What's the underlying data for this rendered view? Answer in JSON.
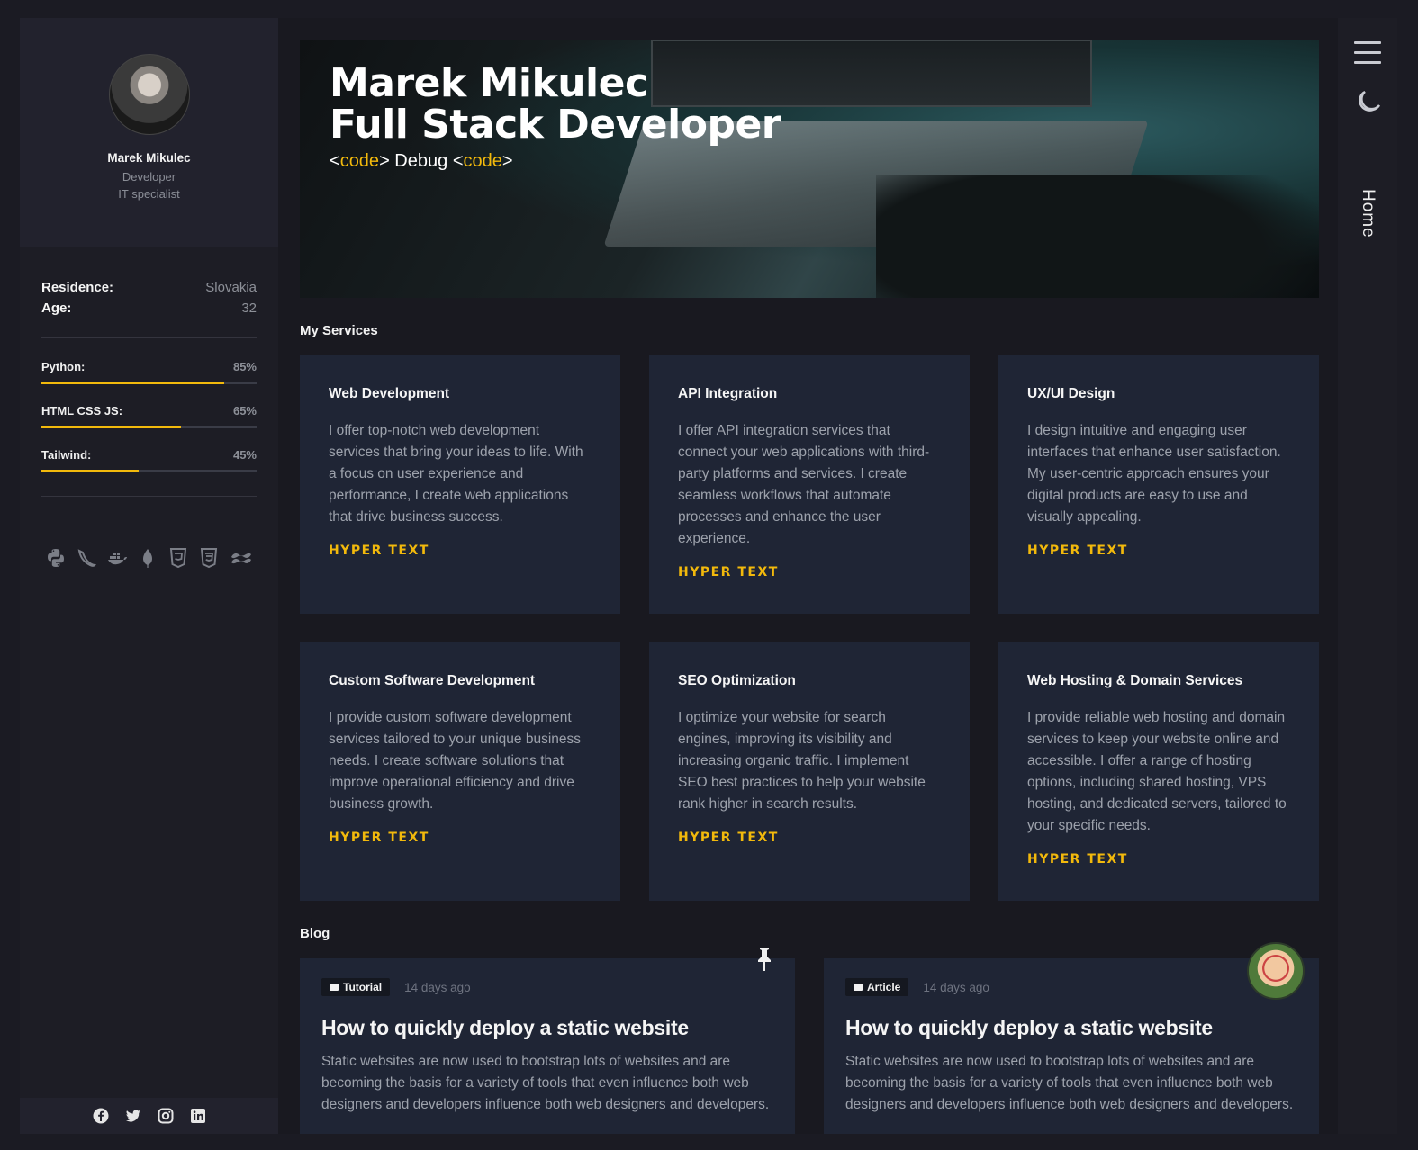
{
  "profile": {
    "name": "Marek Mikulec",
    "role": "Developer",
    "role2": "IT specialist"
  },
  "info": [
    {
      "key": "Residence:",
      "value": "Slovakia"
    },
    {
      "key": "Age:",
      "value": "32"
    }
  ],
  "skills": [
    {
      "name": "Python:",
      "percent_label": "85%",
      "percent": 85
    },
    {
      "name": "HTML CSS JS:",
      "percent_label": "65%",
      "percent": 65
    },
    {
      "name": "Tailwind:",
      "percent_label": "45%",
      "percent": 45
    }
  ],
  "tech_icons": [
    "python-icon",
    "flask-icon",
    "docker-icon",
    "mongodb-icon",
    "html5-icon",
    "css3-icon",
    "tailwind-icon"
  ],
  "socials": [
    "facebook-icon",
    "twitter-icon",
    "instagram-icon",
    "linkedin-icon"
  ],
  "hero": {
    "title_line1": "Marek Mikulec",
    "title_line2": "Full Stack Developer",
    "sub_open": "<",
    "sub_tag1": "code",
    "sub_close": ">",
    "sub_word": " Debug ",
    "sub_open2": "<",
    "sub_tag2": "code",
    "sub_close2": ">"
  },
  "services_title": "My Services",
  "services": [
    {
      "title": "Web Development",
      "desc": "I offer top-notch web development services that bring your ideas to life. With a focus on user experience and performance, I create web applications that drive business success.",
      "link": "HYPER TEXT"
    },
    {
      "title": "API Integration",
      "desc": "I offer API integration services that connect your web applications with third-party platforms and services. I create seamless workflows that automate processes and enhance the user experience.",
      "link": "HYPER TEXT"
    },
    {
      "title": "UX/UI Design",
      "desc": "I design intuitive and engaging user interfaces that enhance user satisfaction. My user-centric approach ensures your digital products are easy to use and visually appealing.",
      "link": "HYPER TEXT"
    },
    {
      "title": "Custom Software Development",
      "desc": "I provide custom software development services tailored to your unique business needs. I create software solutions that improve operational efficiency and drive business growth.",
      "link": "HYPER TEXT"
    },
    {
      "title": "SEO Optimization",
      "desc": "I optimize your website for search engines, improving its visibility and increasing organic traffic. I implement SEO best practices to help your website rank higher in search results.",
      "link": "HYPER TEXT"
    },
    {
      "title": "Web Hosting & Domain Services",
      "desc": "I provide reliable web hosting and domain services to keep your website online and accessible. I offer a range of hosting options, including shared hosting, VPS hosting, and dedicated servers, tailored to your specific needs.",
      "link": "HYPER TEXT"
    }
  ],
  "blog_title": "Blog",
  "posts": [
    {
      "badge": "Tutorial",
      "time": "14 days ago",
      "title": "How to quickly deploy a static website",
      "desc": "Static websites are now used to bootstrap lots of websites and are becoming the basis for a variety of tools that even influence both web designers and developers influence both web designers and developers."
    },
    {
      "badge": "Article",
      "time": "14 days ago",
      "title": "How to quickly deploy a static website",
      "desc": "Static websites are now used to bootstrap lots of websites and are becoming the basis for a variety of tools that even influence both web designers and developers influence both web designers and developers."
    }
  ],
  "nav": {
    "home": "Home"
  },
  "colors": {
    "accent": "#f2b90c",
    "card_bg": "#1f2535",
    "page_bg": "#191920"
  }
}
